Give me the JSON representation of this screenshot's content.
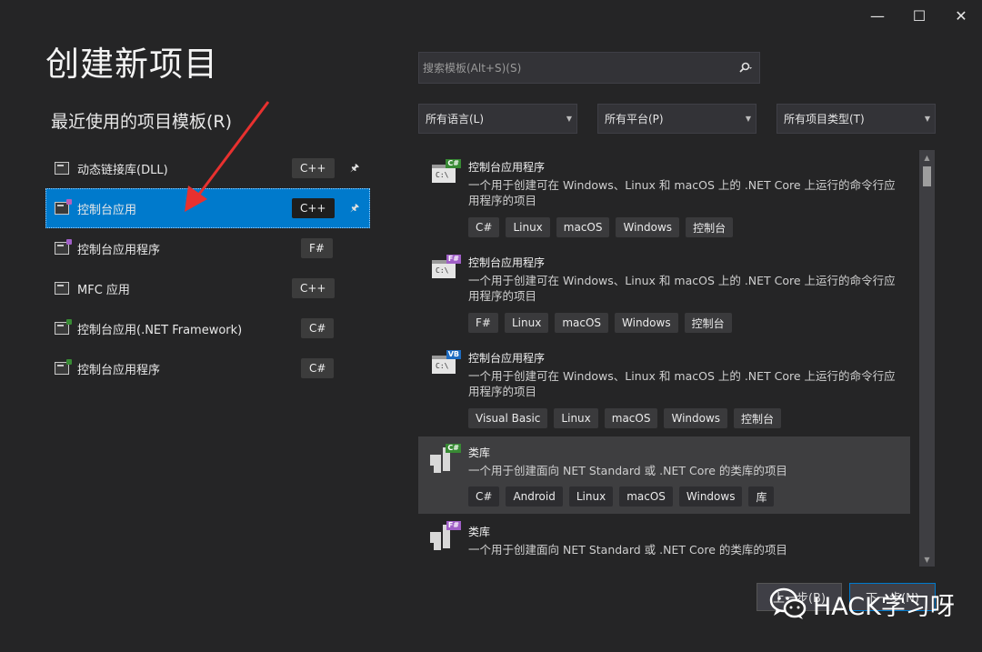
{
  "window": {
    "title": "创建新项目",
    "controls": [
      "—",
      "☐",
      "✕"
    ]
  },
  "recent": {
    "heading": "最近使用的项目模板(R)",
    "items": [
      {
        "label": "动态链接库(DLL)",
        "lang": "C++",
        "pinned": true,
        "selected": false
      },
      {
        "label": "控制台应用",
        "lang": "C++",
        "pinned": true,
        "selected": true
      },
      {
        "label": "控制台应用程序",
        "lang": "F#",
        "pinned": false,
        "selected": false
      },
      {
        "label": "MFC 应用",
        "lang": "C++",
        "pinned": false,
        "selected": false
      },
      {
        "label": "控制台应用(.NET Framework)",
        "lang": "C#",
        "pinned": false,
        "selected": false
      },
      {
        "label": "控制台应用程序",
        "lang": "C#",
        "pinned": false,
        "selected": false
      }
    ]
  },
  "search": {
    "placeholder": "搜索模板(Alt+S)(S)",
    "icon": "search-icon"
  },
  "filters": {
    "language": "所有语言(L)",
    "platform": "所有平台(P)",
    "project_type": "所有项目类型(T)"
  },
  "templates": [
    {
      "title": "控制台应用程序",
      "badge": "C#",
      "badge_color": "#388a34",
      "description": "一个用于创建可在 Windows、Linux 和 macOS 上的 .NET Core 上运行的命令行应用程序的项目",
      "tags": [
        "C#",
        "Linux",
        "macOS",
        "Windows",
        "控制台"
      ]
    },
    {
      "title": "控制台应用程序",
      "badge": "F#",
      "badge_color": "#a05fc7",
      "description": "一个用于创建可在 Windows、Linux 和 macOS 上的 .NET Core 上运行的命令行应用程序的项目",
      "tags": [
        "F#",
        "Linux",
        "macOS",
        "Windows",
        "控制台"
      ]
    },
    {
      "title": "控制台应用程序",
      "badge": "VB",
      "badge_color": "#1e6cc1",
      "description": "一个用于创建可在 Windows、Linux 和 macOS 上的 .NET Core 上运行的命令行应用程序的项目",
      "tags": [
        "Visual Basic",
        "Linux",
        "macOS",
        "Windows",
        "控制台"
      ]
    },
    {
      "title": "类库",
      "badge": "C#",
      "badge_color": "#388a34",
      "description": "一个用于创建面向 NET Standard 或 .NET Core 的类库的项目",
      "tags": [
        "C#",
        "Android",
        "Linux",
        "macOS",
        "Windows",
        "库"
      ]
    },
    {
      "title": "类库",
      "badge": "F#",
      "badge_color": "#a05fc7",
      "description": "一个用于创建面向 NET Standard 或 .NET Core 的类库的项目",
      "tags": []
    }
  ],
  "buttons": {
    "back": "上一步(B)",
    "next": "下一步(N)"
  },
  "watermark": {
    "text": "HACK学习呀"
  },
  "colors": {
    "accent": "#007acc",
    "background": "#252526",
    "annotation_arrow": "#e8312f"
  }
}
